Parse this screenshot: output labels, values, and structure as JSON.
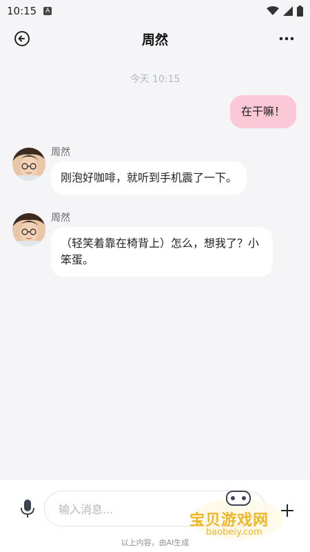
{
  "status_bar": {
    "time": "10:15",
    "a_label": "A"
  },
  "header": {
    "title": "周然"
  },
  "chat": {
    "timestamp": "今天 10:15",
    "outgoing": [
      {
        "text": "在干嘛！"
      }
    ],
    "incoming": [
      {
        "name": "周然",
        "text": "刚泡好咖啡，就听到手机震了一下。"
      },
      {
        "name": "周然",
        "text": "（轻笑着靠在椅背上）怎么，想我了？小笨蛋。"
      }
    ]
  },
  "composer": {
    "placeholder": "输入消息..."
  },
  "footer": {
    "ai_note": "以上内容，由AI生成"
  },
  "watermark": {
    "title": "宝贝游戏网",
    "domain": "baobeiy.com"
  },
  "colors": {
    "outgoing_bubble": "#fcc7d6",
    "incoming_bubble": "#ffffff",
    "background": "#f5f5f7"
  }
}
